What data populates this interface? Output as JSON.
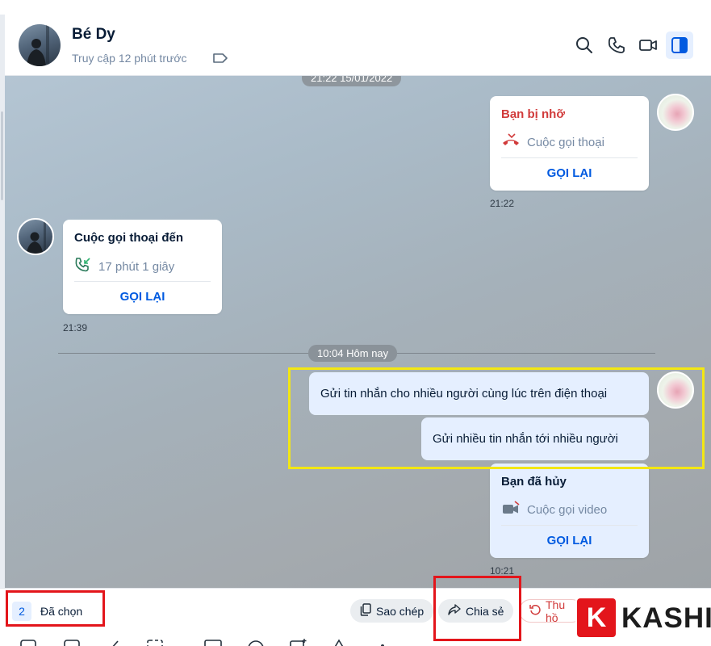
{
  "header": {
    "name": "Bé Dy",
    "status": "Truy cập 12 phút trước",
    "icons": [
      "search-icon",
      "phone-icon",
      "video-icon",
      "sidebar-toggle-icon"
    ]
  },
  "chat": {
    "date_pill_1": "21:22 15/01/2022",
    "missed_call": {
      "title": "Bạn bị nhỡ",
      "detail": "Cuộc gọi thoại",
      "action": "GỌI LẠI",
      "time": "21:22"
    },
    "incoming_call": {
      "title": "Cuộc gọi thoại đến",
      "detail": "17 phút 1 giây",
      "action": "GỌI LẠI",
      "time": "21:39"
    },
    "date_pill_2": "10:04 Hôm nay",
    "messages": [
      "Gửi tin nhắn cho nhiều người cùng lúc trên điện thoại",
      "Gửi nhiều tin nhắn tới nhiều người"
    ],
    "cancelled_call": {
      "title": "Bạn đã hủy",
      "detail": "Cuộc gọi video",
      "action": "GỌI LẠI",
      "time": "10:21"
    }
  },
  "selection_bar": {
    "count": "2",
    "label": "Đã chọn",
    "copy_label": "Sao chép",
    "share_label": "Chia sẻ",
    "recall_label": "Thu hồ"
  },
  "logo": {
    "letter": "K",
    "text": "KASHI"
  },
  "colors": {
    "accent": "#005ae0",
    "bubble": "#e5efff",
    "missed": "#d13b3b",
    "highlight_yellow": "#f3e713",
    "highlight_red": "#e3151b"
  }
}
